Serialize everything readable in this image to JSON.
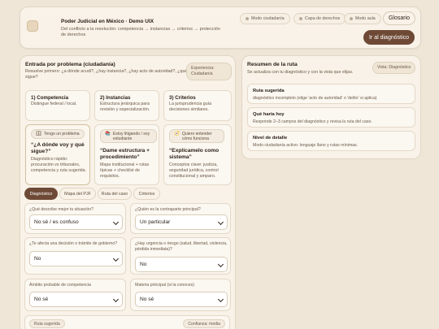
{
  "header": {
    "title": "Poder Judicial en México · Demo UIX",
    "subtitle": "Del conflicto a la resolución: competencia → instancias → criterios → protección de derechos",
    "modes": [
      {
        "label": "Modo ciudadanía",
        "icon": "circle-dot-icon"
      },
      {
        "label": "Capa de derechos",
        "icon": "circle-dot-icon"
      },
      {
        "label": "Modo aula",
        "icon": "circle-dot-icon"
      }
    ],
    "glossary_label": "Glosario",
    "go_diagnosis_label": "Ir al diagnóstico"
  },
  "entry": {
    "title": "Entrada por problema (ciudadanía)",
    "subtitle": "Resuelve primero: ¿a dónde acudí?, ¿hay instancia?, ¿hay acto de autoridad?, ¿qué sigue?",
    "experience_tag": "Experiencia: Ciudadanía",
    "info_cards": [
      {
        "title": "1) Competencia",
        "text": "Distingue federal / local."
      },
      {
        "title": "2) Instancias",
        "text": "Estructura jerárquica para revisión y especialización."
      },
      {
        "title": "3) Criterios",
        "text": "La jurisprudencia guía decisiones similares."
      }
    ],
    "persona_cards": [
      {
        "chip": "Tengo un problema",
        "chip_icon": "🗄",
        "question": "“¿A dónde voy y qué sigue?”",
        "text": "Diagnóstico rápido: procuración vs tribunales, competencia y ruta sugerida."
      },
      {
        "chip": "Estoy litigando / soy estudiante",
        "chip_icon": "📚",
        "question": "“Dame estructura + procedimiento”",
        "text": "Mapa institucional + rutas típicas + checklist de requisitos."
      },
      {
        "chip": "Quiero entender cómo funciona",
        "chip_icon": "🧭",
        "question": "“Explícamelo como sistema”",
        "text": "Conceptos clave: justicia, seguridad jurídica, control constitucional y amparo."
      }
    ],
    "tabs": [
      "Diagnóstico",
      "Mapa del PJF",
      "Ruta del caso",
      "Criterios"
    ],
    "active_tab": "Diagnóstico",
    "fields": [
      {
        "label": "¿Qué describe mejor tu situación?",
        "value": "No sé / es confuso"
      },
      {
        "label": "¿Quién es la contraparte principal?",
        "value": "Un particular"
      },
      {
        "label": "¿Te afecta una decisión o trámite de gobierno?",
        "value": "No"
      },
      {
        "label": "¿Hay urgencia o riesgo (salud, libertad, violencia, pérdida inmediata)?",
        "value": "No"
      },
      {
        "label": "Ámbito probable de competencia",
        "value": "No sé"
      },
      {
        "label": "Materia principal (si la conoces)",
        "value": "No sé"
      }
    ],
    "route_tag": "Ruta sugerida",
    "confidence_tag": "Confianza: media"
  },
  "summary": {
    "title": "Resumen de la ruta",
    "subtitle": "Se actualiza con tu diagnóstico y con la vista que elijas.",
    "view_tag": "Vista: Diagnóstico",
    "items": [
      {
        "title": "Ruta sugerida",
        "text": "diagnóstico incompleto (elige 'acto de autoridad' o 'delito' si aplica)"
      },
      {
        "title": "Qué haría hoy",
        "text": "Responde 2–3 campos del diagnóstico y revisa la ruta del caso."
      },
      {
        "title": "Nivel de detalle",
        "text": "Modo ciudadanía activo: lenguaje llano y rutas mínimas."
      }
    ]
  }
}
